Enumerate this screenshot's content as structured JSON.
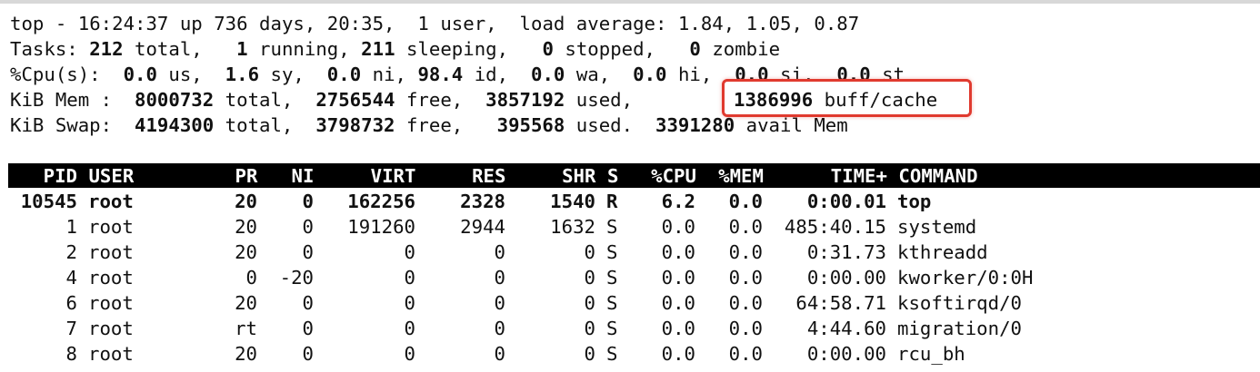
{
  "summary": {
    "uptime": {
      "cmd": "top",
      "time": "16:24:37",
      "up": "736 days, 20:35",
      "users": "1",
      "load": "1.84, 1.05, 0.87"
    },
    "tasks": {
      "total": "212",
      "running": "1",
      "sleeping": "211",
      "stopped": "0",
      "zombie": "0"
    },
    "cpu": {
      "us": "0.0",
      "sy": "1.6",
      "ni": "0.0",
      "id": "98.4",
      "wa": "0.0",
      "hi": "0.0",
      "si": "0.0",
      "st": "0.0"
    },
    "mem": {
      "total": "8000732",
      "free": "2756544",
      "used": "3857192",
      "buff_cache": "1386996"
    },
    "swap": {
      "total": "4194300",
      "free": "3798732",
      "used": "395568",
      "avail_mem": "3391280"
    }
  },
  "highlight_color": "#e03a2f",
  "table": {
    "columns": [
      "PID",
      "USER",
      "PR",
      "NI",
      "VIRT",
      "RES",
      "SHR",
      "S",
      "%CPU",
      "%MEM",
      "TIME+",
      "COMMAND"
    ],
    "rows": [
      {
        "pid": "10545",
        "user": "root",
        "pr": "20",
        "ni": "0",
        "virt": "162256",
        "res": "2328",
        "shr": "1540",
        "s": "R",
        "cpu": "6.2",
        "mem": "0.0",
        "time": "0:00.01",
        "cmd": "top",
        "bold": true
      },
      {
        "pid": "1",
        "user": "root",
        "pr": "20",
        "ni": "0",
        "virt": "191260",
        "res": "2944",
        "shr": "1632",
        "s": "S",
        "cpu": "0.0",
        "mem": "0.0",
        "time": "485:40.15",
        "cmd": "systemd"
      },
      {
        "pid": "2",
        "user": "root",
        "pr": "20",
        "ni": "0",
        "virt": "0",
        "res": "0",
        "shr": "0",
        "s": "S",
        "cpu": "0.0",
        "mem": "0.0",
        "time": "0:31.73",
        "cmd": "kthreadd"
      },
      {
        "pid": "4",
        "user": "root",
        "pr": "0",
        "ni": "-20",
        "virt": "0",
        "res": "0",
        "shr": "0",
        "s": "S",
        "cpu": "0.0",
        "mem": "0.0",
        "time": "0:00.00",
        "cmd": "kworker/0:0H"
      },
      {
        "pid": "6",
        "user": "root",
        "pr": "20",
        "ni": "0",
        "virt": "0",
        "res": "0",
        "shr": "0",
        "s": "S",
        "cpu": "0.0",
        "mem": "0.0",
        "time": "64:58.71",
        "cmd": "ksoftirqd/0"
      },
      {
        "pid": "7",
        "user": "root",
        "pr": "rt",
        "ni": "0",
        "virt": "0",
        "res": "0",
        "shr": "0",
        "s": "S",
        "cpu": "0.0",
        "mem": "0.0",
        "time": "4:44.60",
        "cmd": "migration/0"
      },
      {
        "pid": "8",
        "user": "root",
        "pr": "20",
        "ni": "0",
        "virt": "0",
        "res": "0",
        "shr": "0",
        "s": "S",
        "cpu": "0.0",
        "mem": "0.0",
        "time": "0:00.00",
        "cmd": "rcu_bh"
      }
    ]
  }
}
